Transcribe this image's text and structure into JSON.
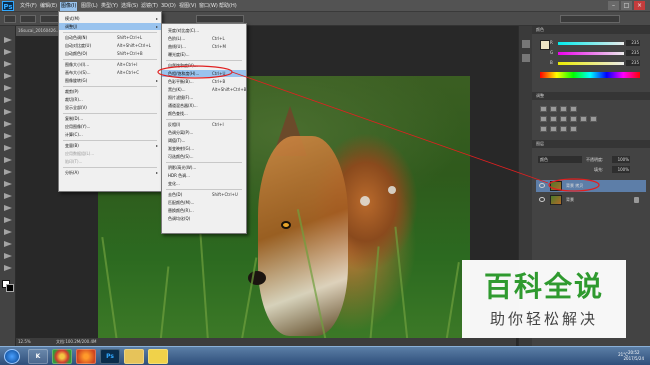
{
  "app": {
    "logo_text": "Ps",
    "menus": [
      "文件(F)",
      "编辑(E)",
      "图像(I)",
      "图层(L)",
      "类型(Y)",
      "选择(S)",
      "滤镜(T)",
      "3D(D)",
      "视图(V)",
      "窗口(W)",
      "帮助(H)"
    ]
  },
  "document": {
    "tab_label": "16sucai_20160426...",
    "zoom": "12.5%",
    "doc_info": "文档:100.2M/200.4M"
  },
  "image_menu": {
    "items": [
      {
        "label": "模式(M)",
        "shortcut": "",
        "submenu": true
      },
      {
        "label": "调整(J)",
        "shortcut": "",
        "submenu": true,
        "highlighted": true
      },
      {
        "label": "自动色调(N)",
        "shortcut": "Shift+Ctrl+L"
      },
      {
        "label": "自动对比度(U)",
        "shortcut": "Alt+Shift+Ctrl+L"
      },
      {
        "label": "自动颜色(O)",
        "shortcut": "Shift+Ctrl+B"
      },
      {
        "label": "图像大小(I)...",
        "shortcut": "Alt+Ctrl+I"
      },
      {
        "label": "画布大小(S)...",
        "shortcut": "Alt+Ctrl+C"
      },
      {
        "label": "图像旋转(G)",
        "shortcut": "",
        "submenu": true
      },
      {
        "label": "裁剪(P)",
        "shortcut": ""
      },
      {
        "label": "裁切(R)...",
        "shortcut": ""
      },
      {
        "label": "显示全部(V)",
        "shortcut": ""
      },
      {
        "label": "复制(D)...",
        "shortcut": ""
      },
      {
        "label": "应用图像(Y)...",
        "shortcut": ""
      },
      {
        "label": "计算(C)...",
        "shortcut": ""
      },
      {
        "label": "变量(B)",
        "shortcut": "",
        "submenu": true
      },
      {
        "label": "应用数据组(L)...",
        "shortcut": "",
        "disabled": true
      },
      {
        "label": "陷印(T)...",
        "shortcut": "",
        "disabled": true
      },
      {
        "label": "分析(A)",
        "shortcut": "",
        "submenu": true
      }
    ]
  },
  "adjust_menu": {
    "items": [
      {
        "label": "亮度/对比度(C)...",
        "shortcut": ""
      },
      {
        "label": "色阶(L)...",
        "shortcut": "Ctrl+L"
      },
      {
        "label": "曲线(U)...",
        "shortcut": "Ctrl+M"
      },
      {
        "label": "曝光度(E)...",
        "shortcut": ""
      },
      {
        "label": "自然饱和度(V)...",
        "shortcut": ""
      },
      {
        "label": "色相/饱和度(H)...",
        "shortcut": "Ctrl+U",
        "highlighted": true
      },
      {
        "label": "色彩平衡(B)...",
        "shortcut": "Ctrl+B"
      },
      {
        "label": "黑白(K)...",
        "shortcut": "Alt+Shift+Ctrl+B"
      },
      {
        "label": "照片滤镜(F)...",
        "shortcut": ""
      },
      {
        "label": "通道混合器(X)...",
        "shortcut": ""
      },
      {
        "label": "颜色查找...",
        "shortcut": ""
      },
      {
        "label": "反相(I)",
        "shortcut": "Ctrl+I"
      },
      {
        "label": "色调分离(P)...",
        "shortcut": ""
      },
      {
        "label": "阈值(T)...",
        "shortcut": ""
      },
      {
        "label": "渐变映射(G)...",
        "shortcut": ""
      },
      {
        "label": "可选颜色(S)...",
        "shortcut": ""
      },
      {
        "label": "阴影/高光(W)...",
        "shortcut": ""
      },
      {
        "label": "HDR 色调...",
        "shortcut": ""
      },
      {
        "label": "变化...",
        "shortcut": ""
      },
      {
        "label": "去色(D)",
        "shortcut": "Shift+Ctrl+U"
      },
      {
        "label": "匹配颜色(M)...",
        "shortcut": ""
      },
      {
        "label": "替换颜色(R)...",
        "shortcut": ""
      },
      {
        "label": "色调均化(Q)",
        "shortcut": ""
      }
    ]
  },
  "color_panel": {
    "tab": "颜色",
    "channels": [
      {
        "label": "R",
        "value": "235"
      },
      {
        "label": "G",
        "value": "235"
      },
      {
        "label": "B",
        "value": "235"
      }
    ]
  },
  "adjust_panel": {
    "tab": "调整"
  },
  "layers_panel": {
    "tab": "图层",
    "blend_mode": "颜色",
    "opacity_label": "不透明度:",
    "opacity": "100%",
    "fill_label": "填充:",
    "fill": "100%",
    "layers": [
      {
        "name": "背景 拷贝",
        "selected": true
      },
      {
        "name": "背景",
        "selected": false
      }
    ]
  },
  "watermark": {
    "title": "百科全说",
    "subtitle": "助你轻松解决"
  },
  "taskbar": {
    "apps": [
      "K",
      "",
      "",
      "Ps",
      "",
      ""
    ],
    "tray": "21°C",
    "time": "20:52",
    "date": "2017/5/24"
  },
  "colors": {
    "highlight": "#99c3ee",
    "annotation": "#e02020",
    "watermark_green": "#2f9a2f"
  }
}
